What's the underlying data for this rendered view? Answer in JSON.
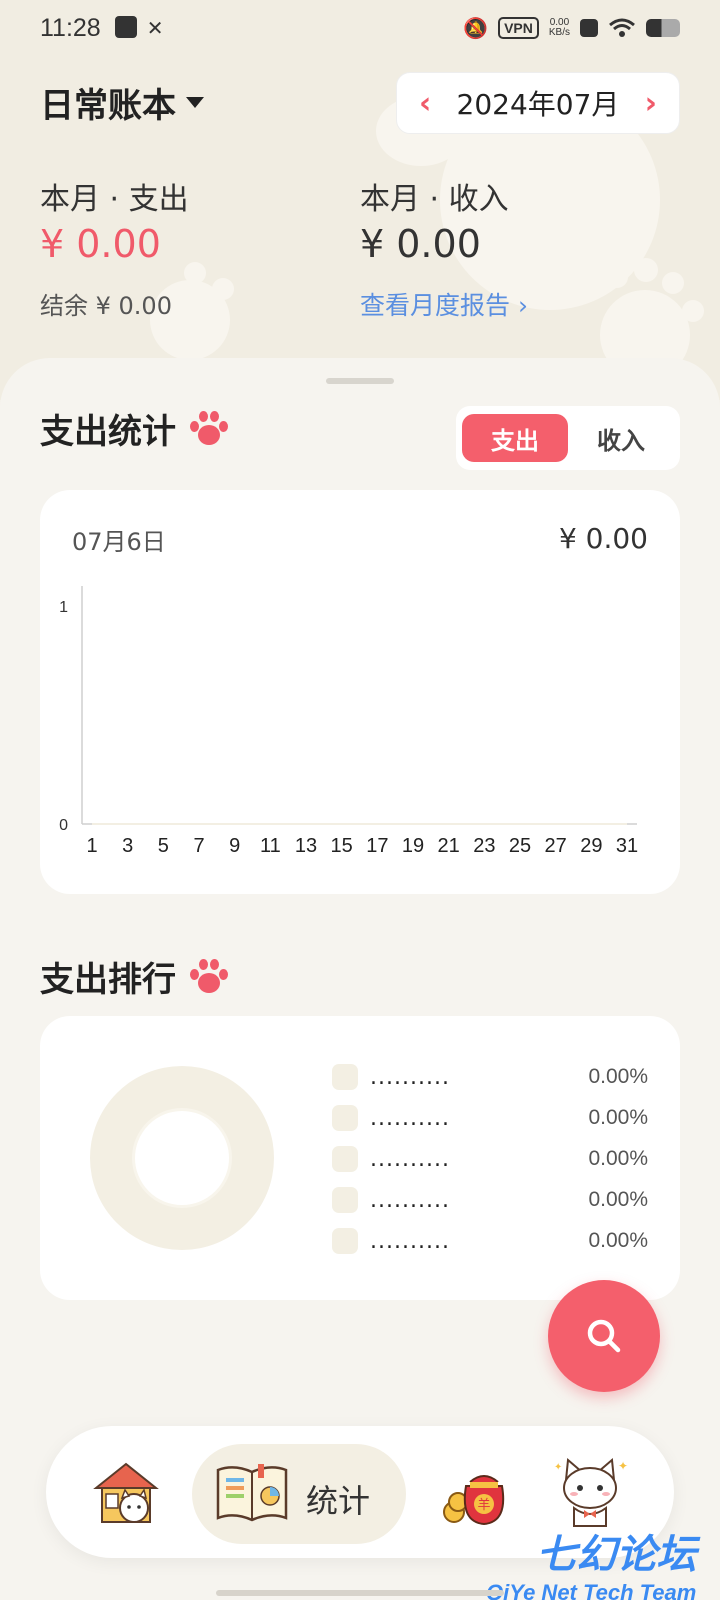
{
  "status_bar": {
    "time": "11:28",
    "vpn": "VPN",
    "netspeed_value": "0.00",
    "netspeed_unit": "KB/s"
  },
  "header": {
    "book_name": "日常账本",
    "month": "2024年07月"
  },
  "summary": {
    "expense_label": "本月 · 支出",
    "expense_amount": "¥ 0.00",
    "income_label": "本月 · 收入",
    "income_amount": "¥ 0.00",
    "balance": "结余 ¥ 0.00",
    "report_link": "查看月度报告 ›"
  },
  "stats": {
    "title": "支出统计",
    "toggle_expense": "支出",
    "toggle_income": "收入",
    "date": "07月6日",
    "total": "¥ 0.00"
  },
  "chart_data": {
    "type": "line",
    "title": "",
    "xlabel": "",
    "ylabel": "",
    "x": [
      1,
      2,
      3,
      4,
      5,
      6,
      7,
      8,
      9,
      10,
      11,
      12,
      13,
      14,
      15,
      16,
      17,
      18,
      19,
      20,
      21,
      22,
      23,
      24,
      25,
      26,
      27,
      28,
      29,
      30,
      31
    ],
    "x_tick_labels": [
      "1",
      "3",
      "5",
      "7",
      "9",
      "11",
      "13",
      "15",
      "17",
      "19",
      "21",
      "23",
      "25",
      "27",
      "29",
      "31"
    ],
    "series": [
      {
        "values": [
          0,
          0,
          0,
          0,
          0,
          0,
          0,
          0,
          0,
          0,
          0,
          0,
          0,
          0,
          0,
          0,
          0,
          0,
          0,
          0,
          0,
          0,
          0,
          0,
          0,
          0,
          0,
          0,
          0,
          0,
          0
        ]
      }
    ],
    "ylim": [
      0,
      1
    ],
    "y_tick_labels": [
      "0",
      "1"
    ],
    "grid": false
  },
  "ranking": {
    "title": "支出排行",
    "items": [
      {
        "name": "..........",
        "pct": "0.00%"
      },
      {
        "name": "..........",
        "pct": "0.00%"
      },
      {
        "name": "..........",
        "pct": "0.00%"
      },
      {
        "name": "..........",
        "pct": "0.00%"
      },
      {
        "name": "..........",
        "pct": "0.00%"
      }
    ]
  },
  "nav": {
    "active_label": "统计"
  },
  "watermark": {
    "cn": "七幻论坛",
    "en": "QiYe Net Tech Team"
  },
  "colors": {
    "accent": "#f45f6c",
    "link": "#5b8fe0",
    "background": "#f4f1ea"
  }
}
